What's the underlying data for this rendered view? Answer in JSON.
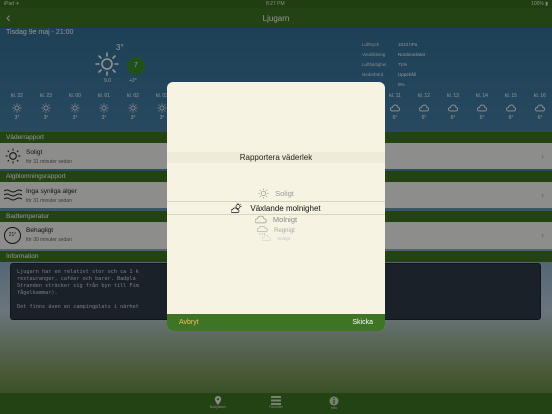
{
  "statusbar": {
    "left": "iPad ✈",
    "time": "8:27 PM",
    "right": "100% ▮"
  },
  "nav": {
    "back_icon": "chevron-left-icon",
    "title": "Ljugarn"
  },
  "date": "Tisdag 9e maj - 21:00",
  "current": {
    "temp": "3°",
    "badge": "7",
    "wind": "9.0",
    "gust": "+2°"
  },
  "stats": [
    {
      "k": "Lufttryck",
      "v": "1013 hPa"
    },
    {
      "k": "Vindriktning",
      "v": "Nordnordväst"
    },
    {
      "k": "Luftfuktighet",
      "v": "71%"
    },
    {
      "k": "Nederbörd",
      "v": "Uppehåll"
    },
    {
      "k": "",
      "v": "0%"
    }
  ],
  "hours": [
    {
      "label": "kl. 22",
      "temp": "3°",
      "icon": "sun"
    },
    {
      "label": "kl. 23",
      "temp": "3°",
      "icon": "sun"
    },
    {
      "label": "kl. 00",
      "temp": "3°",
      "icon": "sun"
    },
    {
      "label": "kl. 01",
      "temp": "3°",
      "icon": "sun"
    },
    {
      "label": "kl. 02",
      "temp": "3°",
      "icon": "sun"
    },
    {
      "label": "kl. 03",
      "temp": "3°",
      "icon": "sun"
    },
    {
      "label": "kl. 11",
      "temp": "6°",
      "icon": "cloud"
    },
    {
      "label": "kl. 12",
      "temp": "6°",
      "icon": "cloud"
    },
    {
      "label": "kl. 13",
      "temp": "6°",
      "icon": "cloud"
    },
    {
      "label": "kl. 14",
      "temp": "6°",
      "icon": "cloud"
    },
    {
      "label": "kl. 15",
      "temp": "6°",
      "icon": "cloud"
    },
    {
      "label": "kl. 16",
      "temp": "6°",
      "icon": "cloud"
    }
  ],
  "sections": {
    "weather": "Väderrapport",
    "algae": "Algblomningsrapport",
    "bath": "Badtemperatur",
    "info": "Information"
  },
  "weather_card": {
    "title": "Soligt",
    "sub": "för 31 minuter sedan"
  },
  "algae_card": {
    "title": "Inga synliga alger",
    "sub": "för 31 minuter sedan"
  },
  "bath_card": {
    "title": "Behagligt",
    "sub": "för 30 minuter sedan",
    "temp": "21°"
  },
  "info_text": "Ljugarn har en relativt stor och ca 1 k                                          uranger. Det lilla samhället erbjuder\nrestauranger, caféer och barer. Badpla                                          tt som mestgolt tillgängligt.\nStranden sträcker sig från byn till Fim                                          att du inte uttalar det\nfågelkammar).\n\nDet finns även en campingplats i närhet",
  "tabs": [
    {
      "label": "Badplatser",
      "icon": "location-pin-icon"
    },
    {
      "label": "Favoriter",
      "icon": "list-icon"
    },
    {
      "label": "Info",
      "icon": "info-icon"
    }
  ],
  "dialog": {
    "title": "Rapportera väderlek",
    "options": [
      {
        "label": "Soligt",
        "icon": "sun-icon"
      },
      {
        "label": "Växlande molnighet",
        "icon": "partly-cloudy-icon"
      },
      {
        "label": "Molnigt",
        "icon": "cloud-icon"
      },
      {
        "label": "Regnigt",
        "icon": "rain-icon"
      },
      {
        "label": "Snöigt",
        "icon": "snow-icon"
      }
    ],
    "cancel": "Avbryt",
    "send": "Skicka"
  }
}
